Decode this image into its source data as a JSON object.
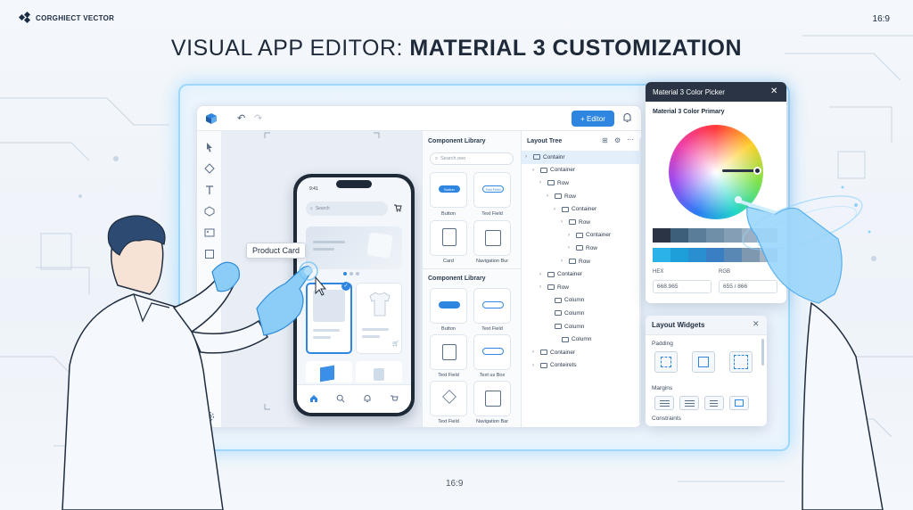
{
  "brand": {
    "name": "CORGHIECT VECTOR"
  },
  "ratio_top": "16:9",
  "ratio_bottom": "16:9",
  "title": {
    "light": "VISUAL APP EDITOR: ",
    "bold": "MATERIAL 3 CUSTOMIZATION"
  },
  "toolbar": {
    "editor_button": "+ Editor"
  },
  "phone": {
    "status_time": "9:41",
    "search_placeholder": "Search",
    "cart_badge": "1"
  },
  "tooltip": "Product Card",
  "component_library_top": {
    "title": "Component Library",
    "search_placeholder": "Search oeo",
    "tiles": [
      "Button",
      "Text Field",
      "Card",
      "Navigation Bur"
    ],
    "tile_samples": [
      "Button",
      "Text Field"
    ]
  },
  "component_library_bottom": {
    "title": "Component Library",
    "tiles": [
      "Button",
      "Text Field",
      "Text Field",
      "Text us Box",
      "Text Field",
      "Navigation Bar"
    ]
  },
  "layout_tree": {
    "title": "Layout Tree",
    "rows": [
      {
        "label": "Containr",
        "depth": 0,
        "selected": true
      },
      {
        "label": "Container",
        "depth": 1
      },
      {
        "label": "Row",
        "depth": 2
      },
      {
        "label": "Row",
        "depth": 3
      },
      {
        "label": "Container",
        "depth": 4
      },
      {
        "label": "Row",
        "depth": 5
      },
      {
        "label": "Container",
        "depth": 6
      },
      {
        "label": "Row",
        "depth": 6
      },
      {
        "label": "Row",
        "depth": 5
      },
      {
        "label": "Container",
        "depth": 2
      },
      {
        "label": "Row",
        "depth": 2
      },
      {
        "label": "Column",
        "depth": 3
      },
      {
        "label": "Column",
        "depth": 3
      },
      {
        "label": "Column",
        "depth": 3
      },
      {
        "label": "Column",
        "depth": 4
      },
      {
        "label": "Container",
        "depth": 1
      },
      {
        "label": "Conteirets",
        "depth": 1
      }
    ]
  },
  "color_picker": {
    "title": "Material 3 Color Picker",
    "subtitle": "Material 3 Color Primary",
    "hex_label": "HEX",
    "rgb_label": "RGB",
    "hex_value": "668.965",
    "rgb_value": "655 / 866",
    "swatches_row1": [
      "#2a3444",
      "#3d5f7a",
      "#5a7e9a",
      "#6f8fa8",
      "#849fb5",
      "#9bb1c3",
      "#b0c2d1"
    ],
    "swatches_row2": [
      "#2bb3e8",
      "#1e9fd9",
      "#2a8fd0",
      "#3a7fc4",
      "#5a88b5",
      "#7e98b0",
      "#a2b3c4"
    ]
  },
  "layout_widgets": {
    "title": "Layout Widgets",
    "padding_label": "Padding",
    "margins_label": "Margins",
    "constraints_label": "Constraints"
  },
  "colors": {
    "accent": "#2f86e0",
    "dark": "#2a3444",
    "glow": "#9fd7fb"
  }
}
